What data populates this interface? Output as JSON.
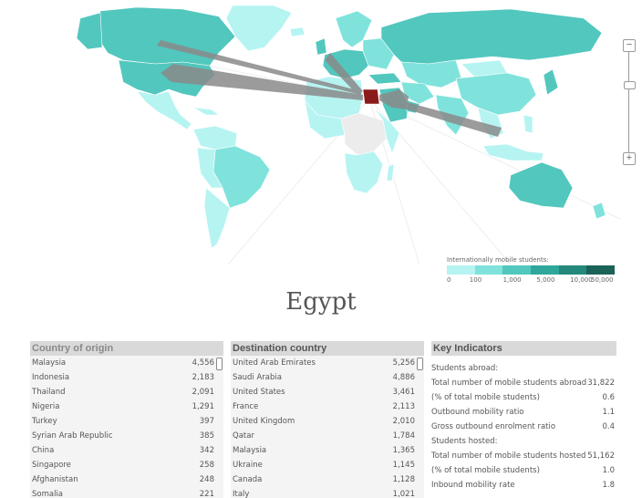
{
  "country": "Egypt",
  "legend": {
    "title": "Internationally mobile students:",
    "colors": [
      "#b6f4f2",
      "#7fe3dc",
      "#52c7be",
      "#2fa79b",
      "#24887c",
      "#1b6259"
    ],
    "ticks": [
      "0",
      "100",
      "1,000",
      "5,000",
      "10,000",
      "50,000"
    ]
  },
  "zoom": {
    "in_symbol": "−",
    "out_symbol": "+"
  },
  "map_colors": {
    "ocean": "#ffffff",
    "no_data": "#ececec",
    "selected": "#8b1a1a",
    "flow": "#8a8a8a"
  },
  "origin_panel": {
    "header": "Country of origin",
    "rows": [
      {
        "name": "Malaysia",
        "value": "4,556"
      },
      {
        "name": "Indonesia",
        "value": "2,183"
      },
      {
        "name": "Thailand",
        "value": "2,091"
      },
      {
        "name": "Nigeria",
        "value": "1,291"
      },
      {
        "name": "Turkey",
        "value": "397"
      },
      {
        "name": "Syrian Arab Republic",
        "value": "385"
      },
      {
        "name": "China",
        "value": "342"
      },
      {
        "name": "Singapore",
        "value": "258"
      },
      {
        "name": "Afghanistan",
        "value": "248"
      },
      {
        "name": "Somalia",
        "value": "221"
      }
    ]
  },
  "destination_panel": {
    "header": "Destination country",
    "rows": [
      {
        "name": "United Arab Emirates",
        "value": "5,256"
      },
      {
        "name": "Saudi Arabia",
        "value": "4,886"
      },
      {
        "name": "United States",
        "value": "3,461"
      },
      {
        "name": "France",
        "value": "2,113"
      },
      {
        "name": "United Kingdom",
        "value": "2,010"
      },
      {
        "name": "Qatar",
        "value": "1,784"
      },
      {
        "name": "Malaysia",
        "value": "1,365"
      },
      {
        "name": "Ukraine",
        "value": "1,145"
      },
      {
        "name": "Canada",
        "value": "1,128"
      },
      {
        "name": "Italy",
        "value": "1,021"
      }
    ]
  },
  "key_indicators": {
    "header": "Key Indicators",
    "rows": [
      {
        "name": "Students abroad:",
        "value": ""
      },
      {
        "name": "Total number of mobile students abroad",
        "value": "31,822"
      },
      {
        "name": "(% of total mobile students)",
        "value": "0.6"
      },
      {
        "name": "Outbound mobility ratio",
        "value": "1.1"
      },
      {
        "name": "Gross outbound enrolment ratio",
        "value": "0.4"
      },
      {
        "name": "Students hosted:",
        "value": ""
      },
      {
        "name": "Total number of mobile students hosted",
        "value": "51,162"
      },
      {
        "name": "(% of total mobile students)",
        "value": "1.0"
      },
      {
        "name": "Inbound mobility rate",
        "value": "1.8"
      }
    ]
  }
}
